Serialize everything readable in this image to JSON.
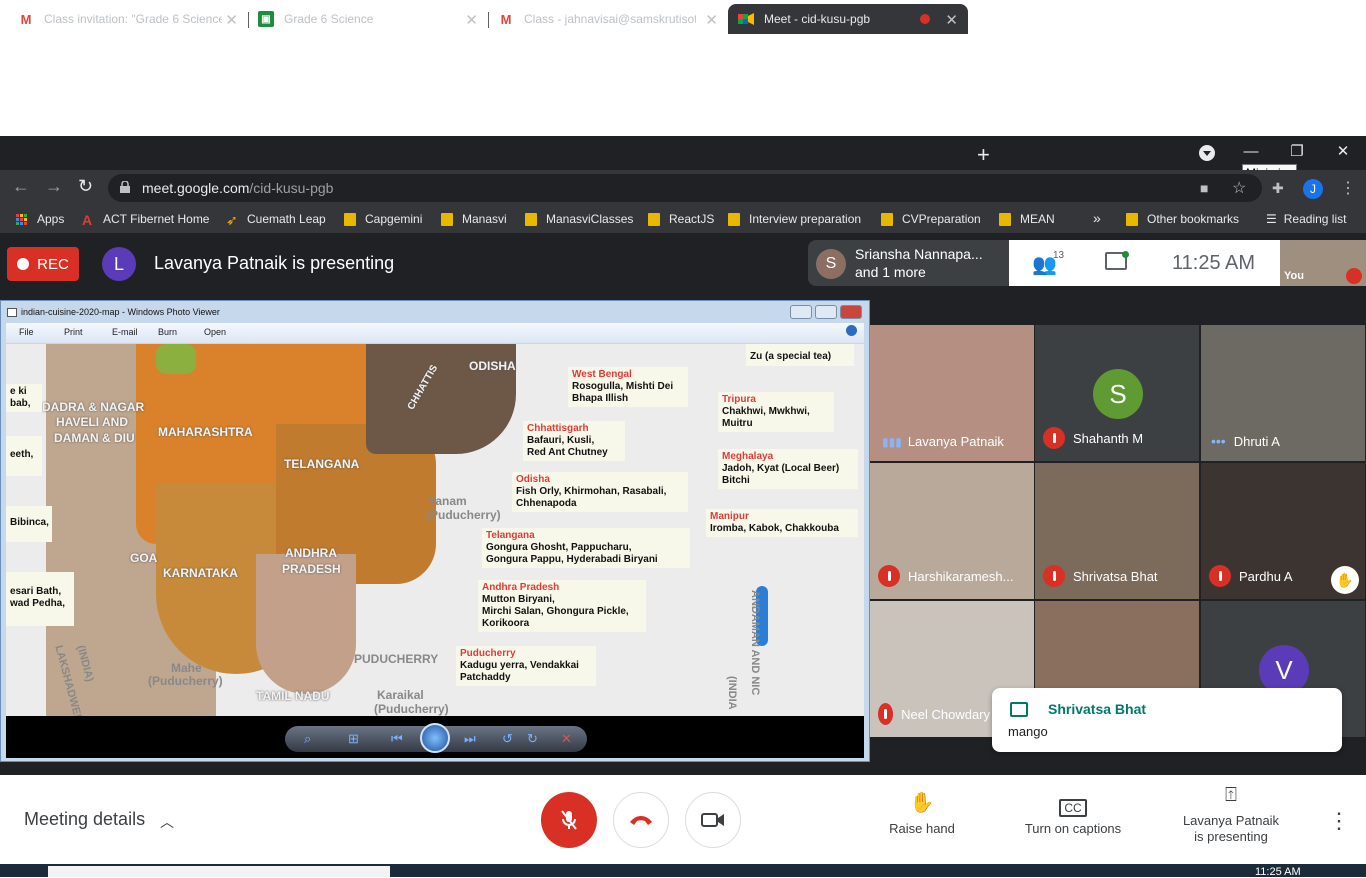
{
  "browser": {
    "tabs": [
      {
        "title": "Class invitation: \"Grade 6 Science",
        "icon": "gmail-icon"
      },
      {
        "title": "Grade 6 Science",
        "icon": "classroom-icon"
      },
      {
        "title": "Class - jahnavisai@samskrutisot.c",
        "icon": "gmail-icon"
      },
      {
        "title": "Meet - cid-kusu-pgb",
        "icon": "meet-icon",
        "active": true,
        "recording": true
      }
    ],
    "tooltip": "Minimize",
    "url_host": "meet.google.com",
    "url_path": "/cid-kusu-pgb",
    "profile_initial": "J",
    "bookmarks": [
      {
        "label": "Apps",
        "type": "apps"
      },
      {
        "label": "ACT Fibernet Home",
        "type": "site"
      },
      {
        "label": "Cuemath Leap",
        "type": "site"
      },
      {
        "label": "Capgemini",
        "type": "folder"
      },
      {
        "label": "Manasvi",
        "type": "folder"
      },
      {
        "label": "ManasviClasses",
        "type": "folder"
      },
      {
        "label": "ReactJS",
        "type": "folder"
      },
      {
        "label": "Interview preparation",
        "type": "folder"
      },
      {
        "label": "CVPreparation",
        "type": "folder"
      },
      {
        "label": "MEAN",
        "type": "folder"
      }
    ],
    "overflow": "»",
    "other_bookmarks": "Other bookmarks",
    "reading_list": "Reading list"
  },
  "meet": {
    "rec_label": "REC",
    "presenter_initial": "L",
    "presenting_text": "Lavanya Patnaik is presenting",
    "active_speaker_initial": "S",
    "active_speaker_line1": "Sriansha Nannapa...",
    "active_speaker_line2": "and 1 more",
    "people_count": "13",
    "time": "11:25 AM",
    "self_label": "You",
    "participants": [
      {
        "name": "Lavanya Patnaik",
        "state": "speaking"
      },
      {
        "name": "Shahanth M",
        "state": "muted",
        "initial": "S",
        "avatar_color": "#5f9b32"
      },
      {
        "name": "Dhruti A",
        "state": "dots"
      },
      {
        "name": "Harshikaramesh...",
        "state": "muted"
      },
      {
        "name": "Shrivatsa Bhat",
        "state": "muted"
      },
      {
        "name": "Pardhu A",
        "state": "muted",
        "hand": true
      },
      {
        "name": "Neel Chowdary",
        "state": "muted"
      },
      {
        "name": "",
        "state": "video"
      },
      {
        "name": "",
        "state": "avatar",
        "initial": "V",
        "avatar_color": "#5b3bb8"
      }
    ],
    "chat": {
      "sender": "Shrivatsa Bhat",
      "message": "mango"
    },
    "meeting_details": "Meeting details",
    "raise_hand": "Raise hand",
    "captions": "Turn on captions",
    "presenting_line1": "Lavanya Patnaik",
    "presenting_line2": "is presenting"
  },
  "photo_viewer": {
    "title": "indian-cuisine-2020-map - Windows Photo Viewer",
    "menu": [
      "File",
      "Print",
      "E-mail",
      "Burn",
      "Open"
    ],
    "map_labels": {
      "dadra1": "DADRA & NAGAR",
      "dadra2": "HAVELI AND",
      "dadra3": "DAMAN & DIU",
      "maharashtra": "MAHARASHTRA",
      "telangana": "TELANGANA",
      "odisha": "ODISHA",
      "chhattis": "CHHATTIS",
      "goa": "GOA",
      "karnataka": "KARNATAKA",
      "andhra1": "ANDHRA",
      "andhra2": "PRADESH",
      "puducherry": "PUDUCHERRY",
      "tamilnadu": "TAMIL NADU",
      "yanam1": "Yanam",
      "yanam2": "(Puducherry)",
      "mahe1": "Mahe",
      "mahe2": "(Puducherry)",
      "karaikal1": "Karaikal",
      "karaikal2": "(Puducherry)",
      "lakshadweep1": "LAKSHADWEEP",
      "lakshadweep2": "(INDIA)",
      "andaman1": "ANDAMAN AND NIC",
      "andaman2": "(INDIA",
      "left1a": "e ki",
      "left1b": "bab,",
      "left2": "eeth,",
      "left3": "Bibinca,",
      "left4a": "esari Bath,",
      "left4b": "wad Pedha,"
    },
    "boxes": {
      "mizoram": {
        "line1": "Zu (a special tea)"
      },
      "westbengal": {
        "heading": "West Bengal",
        "line1": "Rosogulla, Mishti Dei",
        "line2": "Bhapa Illish"
      },
      "tripura": {
        "heading": "Tripura",
        "line1": "Chakhwi, Mwkhwi,",
        "line2": "Muitru"
      },
      "chhattisgarh": {
        "heading": "Chhattisgarh",
        "line1": "Bafauri, Kusli,",
        "line2": "Red Ant Chutney"
      },
      "meghalaya": {
        "heading": "Meghalaya",
        "line1": "Jadoh, Kyat (Local Beer)",
        "line2": "Bitchi"
      },
      "odisha": {
        "heading": "Odisha",
        "line1": "Fish Orly, Khirmohan, Rasabali,",
        "line2": "Chhenapoda"
      },
      "manipur": {
        "heading": "Manipur",
        "line1": "Iromba, Kabok, Chakkouba"
      },
      "telangana": {
        "heading": "Telangana",
        "line1": "Gongura Ghosht, Pappucharu,",
        "line2": "Gongura Pappu, Hyderabadi Biryani"
      },
      "andhra": {
        "heading": "Andhra Pradesh",
        "line1": "Mutton Biryani,",
        "line2": "Mirchi Salan, Ghongura Pickle,",
        "line3": "Korikoora"
      },
      "puducherry": {
        "heading": "Puducherry",
        "line1": "Kadugu yerra, Vendakkai",
        "line2": "Patchaddy"
      }
    }
  },
  "taskbar": {
    "time": "11:25 AM"
  }
}
